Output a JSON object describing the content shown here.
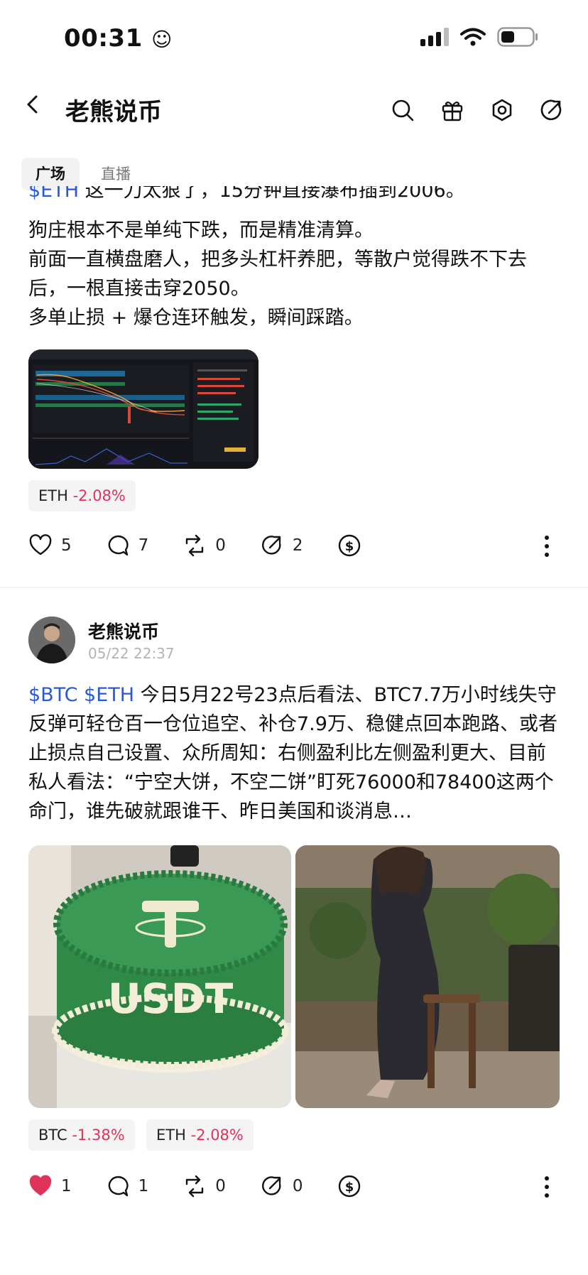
{
  "status": {
    "time": "00:31"
  },
  "header": {
    "title": "老熊说币"
  },
  "tabs": [
    {
      "label": "广场"
    },
    {
      "label": "直播"
    }
  ],
  "post1": {
    "partial_line_link": "$ETH",
    "partial_line_text": " 这一刀太狠了，15分钟直接瀑布插到2006。",
    "lines": [
      "狗庄根本不是单纯下跌，而是精准清算。",
      "前面一直横盘磨人，把多头杠杆养肥，等散户觉得跌不下去后，一根直接击穿2050。",
      "多单止损 + 爆仓连环触发，瞬间踩踏。"
    ],
    "tags": [
      {
        "symbol": "ETH",
        "change": "-2.08%"
      }
    ],
    "actions": {
      "likes": "5",
      "comments": "7",
      "reposts": "0",
      "shares": "2"
    }
  },
  "post2": {
    "author": "老熊说币",
    "time": "05/22 22:37",
    "tickers": "$BTC $ETH",
    "text": " 今日5月22号23点后看法、BTC7.7万小时线失守反弹可轻仓百一仓位追空、补仓7.9万、稳健点回本跑路、或者止损点自己设置、众所周知：右侧盈利比左侧盈利更大、目前私人看法：“宁空大饼，不空二饼”盯死76000和78400这两个命门，谁先破就跟谁干、昨日美国和谈消息…",
    "image1_label": "USDT",
    "tags": [
      {
        "symbol": "BTC",
        "change": "-1.38%"
      },
      {
        "symbol": "ETH",
        "change": "-2.08%"
      }
    ],
    "actions": {
      "likes": "1",
      "comments": "1",
      "reposts": "0",
      "shares": "0"
    }
  },
  "colors": {
    "link": "#2b58d9",
    "negative": "#e0325a",
    "liked": "#e0325a"
  },
  "icons": [
    "back-icon",
    "search-icon",
    "gift-icon",
    "settings-icon",
    "share-icon",
    "heart-icon",
    "comment-icon",
    "repost-icon",
    "share-arrow-icon",
    "tip-icon",
    "more-icon"
  ]
}
